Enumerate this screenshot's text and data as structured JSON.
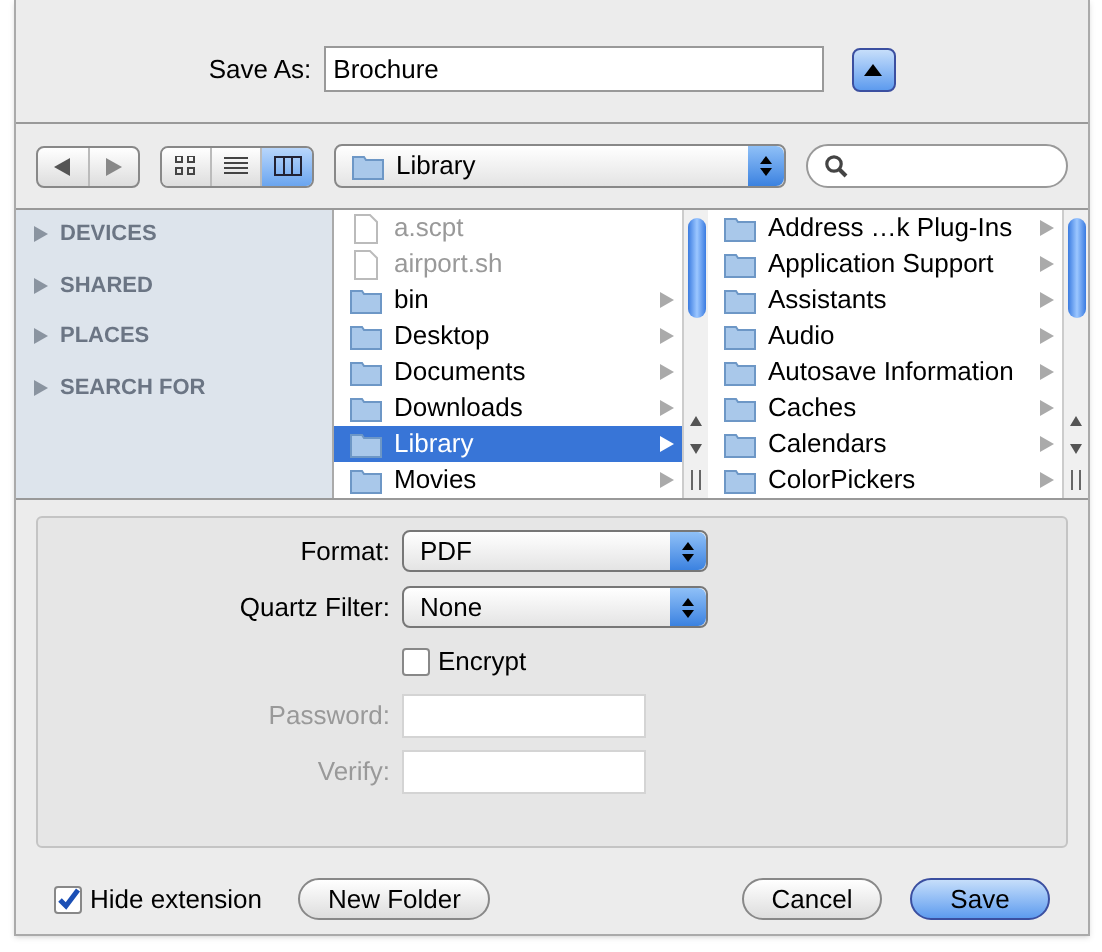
{
  "save_as": {
    "label": "Save As:",
    "value": "Brochure",
    "expanded": true
  },
  "toolbar": {
    "view_modes": [
      {
        "kind": "icons",
        "selected": false
      },
      {
        "kind": "list",
        "selected": false
      },
      {
        "kind": "columns",
        "selected": true
      }
    ],
    "location": "Library"
  },
  "sidebar": {
    "sections": [
      {
        "label": "DEVICES",
        "expanded": false
      },
      {
        "label": "SHARED",
        "expanded": false
      },
      {
        "label": "PLACES",
        "expanded": false
      },
      {
        "label": "SEARCH FOR",
        "expanded": false
      }
    ]
  },
  "columns": [
    {
      "items": [
        {
          "name": "a.scpt",
          "kind": "file",
          "disabled": true,
          "selected": false
        },
        {
          "name": "airport.sh",
          "kind": "file",
          "disabled": true,
          "selected": false
        },
        {
          "name": "bin",
          "kind": "folder",
          "disabled": false,
          "selected": false
        },
        {
          "name": "Desktop",
          "kind": "folder",
          "disabled": false,
          "selected": false
        },
        {
          "name": "Documents",
          "kind": "folder",
          "disabled": false,
          "selected": false
        },
        {
          "name": "Downloads",
          "kind": "folder",
          "disabled": false,
          "selected": false
        },
        {
          "name": "Library",
          "kind": "folder",
          "disabled": false,
          "selected": true
        },
        {
          "name": "Movies",
          "kind": "folder",
          "disabled": false,
          "selected": false
        }
      ]
    },
    {
      "items": [
        {
          "name": "Address …k Plug-Ins",
          "kind": "folder",
          "disabled": false,
          "selected": false
        },
        {
          "name": "Application Support",
          "kind": "folder",
          "disabled": false,
          "selected": false
        },
        {
          "name": "Assistants",
          "kind": "folder",
          "disabled": false,
          "selected": false
        },
        {
          "name": "Audio",
          "kind": "folder",
          "disabled": false,
          "selected": false
        },
        {
          "name": "Autosave Information",
          "kind": "folder",
          "disabled": false,
          "selected": false
        },
        {
          "name": "Caches",
          "kind": "folder",
          "disabled": false,
          "selected": false
        },
        {
          "name": "Calendars",
          "kind": "folder",
          "disabled": false,
          "selected": false
        },
        {
          "name": "ColorPickers",
          "kind": "folder",
          "disabled": false,
          "selected": false
        }
      ]
    }
  ],
  "options": [
    {
      "kind": "popup",
      "label": "Format:",
      "value": "PDF"
    },
    {
      "kind": "popup",
      "label": "Quartz Filter:",
      "value": "None"
    },
    {
      "kind": "checkbox",
      "label": "Encrypt",
      "checked": false
    },
    {
      "kind": "field",
      "label": "Password:",
      "disabled": true
    },
    {
      "kind": "field",
      "label": "Verify:",
      "disabled": true
    }
  ],
  "footer": {
    "hide_extension": {
      "label": "Hide extension",
      "checked": true
    },
    "new_folder": "New Folder",
    "cancel": "Cancel",
    "save": "Save"
  }
}
